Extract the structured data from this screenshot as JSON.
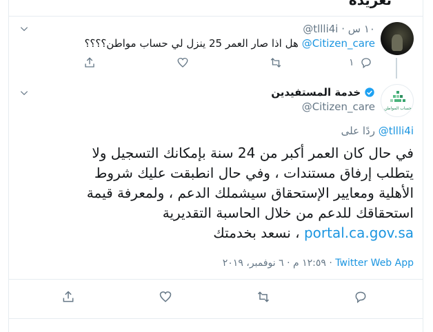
{
  "top_fragment": "تغريدة",
  "reply_tweet": {
    "handle": "@tllli4i",
    "time": "١٠ س",
    "text_prefix": "هل اذا صار العمر 25 ينزل لي حساب مواطن؟؟؟؟",
    "mention": "@Citizen_care",
    "reply_count": "١"
  },
  "main_tweet": {
    "display_name": "خدمة المستفيدين",
    "handle": "@Citizen_care",
    "avatar_caption": "حساب المواطن",
    "replying_to_label": "ردًا على",
    "replying_to_handle": "@tllli4i",
    "lines": [
      "في حال كان العمر أكبر من 24 سنة بإمكانك التسجيل ولا",
      "يتطلب إرفاق مستندات ، وفي حال انطبقت عليك شروط",
      "الأهلية ومعايير الإستحقاق سيشملك الدعم ، ولمعرفة قيمة",
      "استحقاقك للدعم من خلال الحاسبة التقديرية"
    ],
    "last_line_link": "portal.ca.gov.sa",
    "last_line_text": "، نسعد بخدمتك",
    "timestamp": "١٢:٥٩ م · ٦ نوفمبر، ٢٠١٩",
    "source": "Twitter Web App"
  },
  "colors": {
    "link": "#1b95e0",
    "muted": "#657786",
    "border": "#e6ecf0",
    "verified": "#1da1f2"
  },
  "icons": [
    "chevron-down-icon",
    "share-icon",
    "like-icon",
    "retweet-icon",
    "reply-icon",
    "verified-icon"
  ]
}
